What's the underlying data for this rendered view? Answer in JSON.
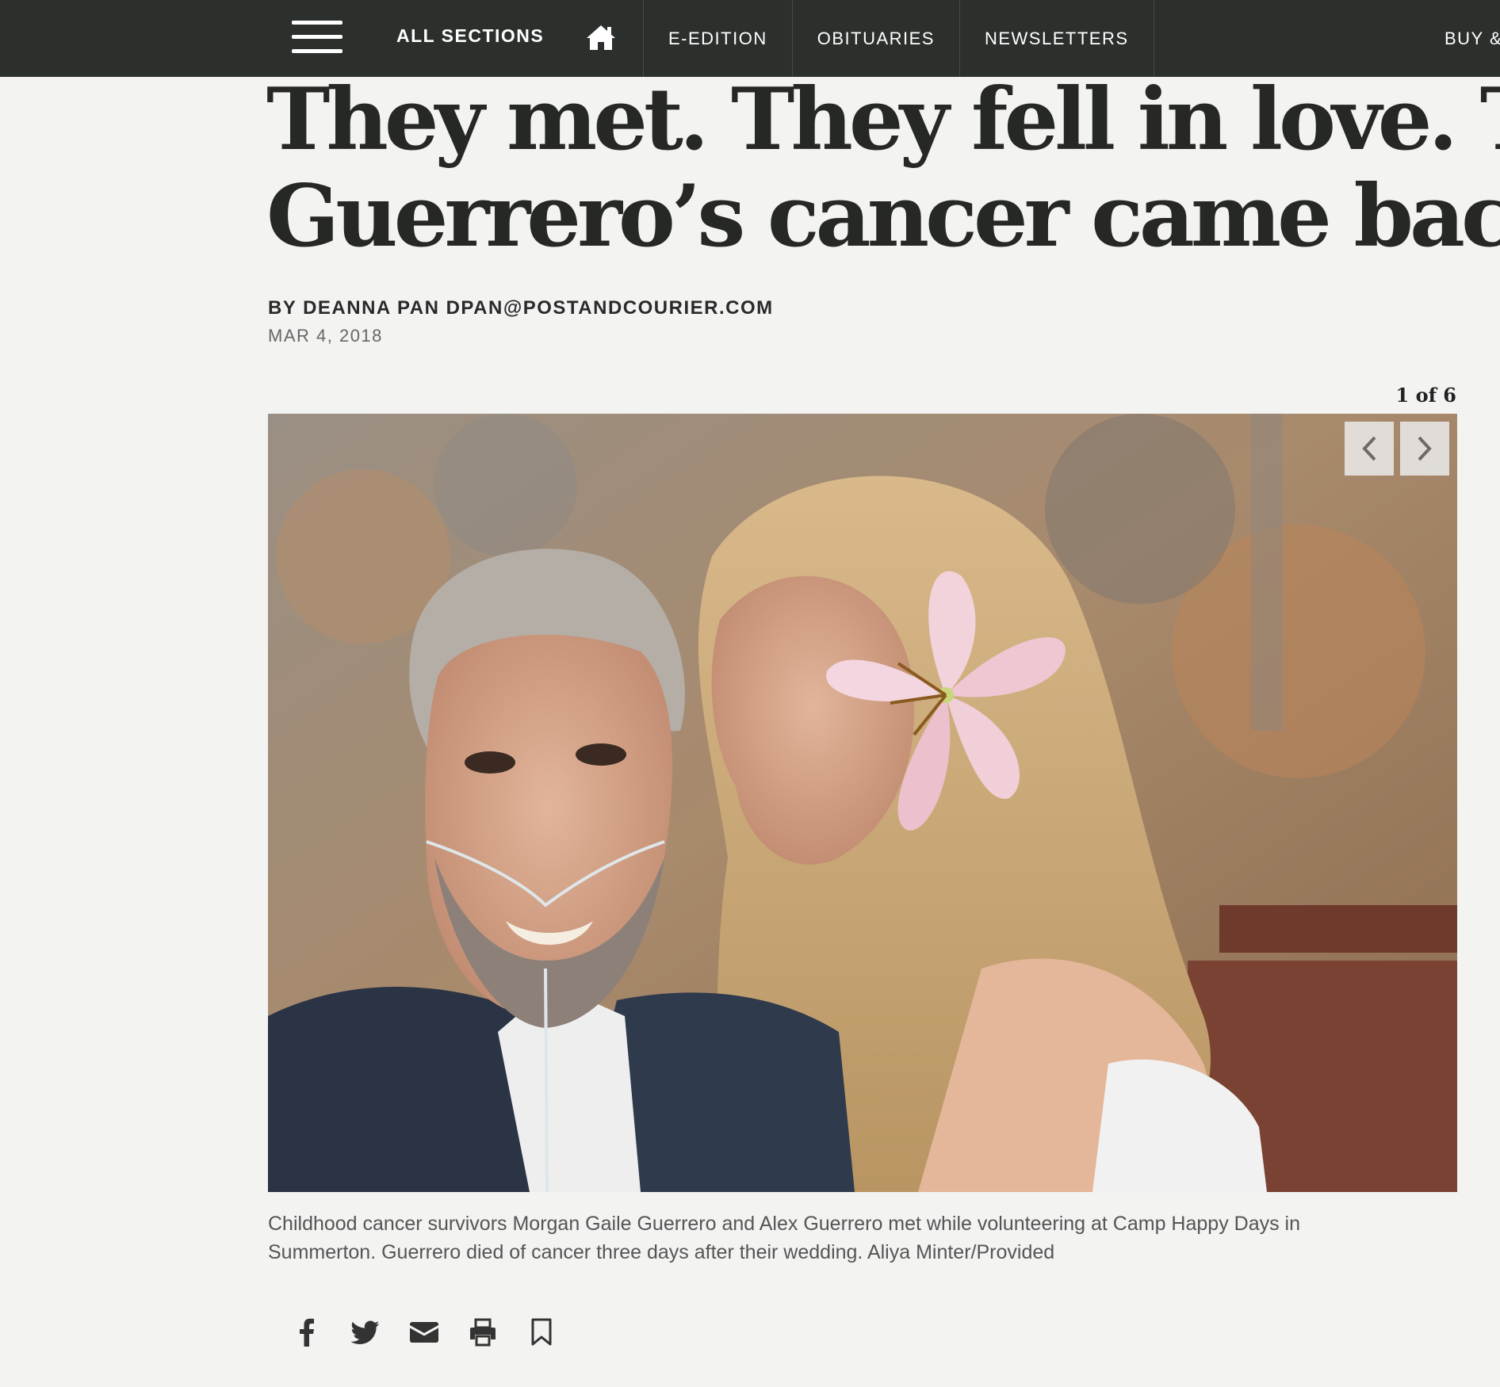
{
  "nav": {
    "all_sections": "ALL SECTIONS",
    "links": [
      "E-EDITION",
      "OBITUARIES",
      "NEWSLETTERS"
    ],
    "right_partial": "BUY &",
    "icons": [
      "menu-icon",
      "home-icon"
    ]
  },
  "article": {
    "headline_line1": "They met. They fell in love. Then Alex",
    "headline_line2": "Guerrero’s cancer came back",
    "byline_prefix": "BY",
    "author": "DEANNA PAN",
    "email": "DPAN@POSTANDCOURIER.COM",
    "date": "MAR 4, 2018"
  },
  "gallery": {
    "counter": "1 of 6",
    "caption": "Childhood cancer survivors Morgan Gaile Guerrero and Alex Guerrero met while volunteering at Camp Happy Days in Summerton. Guerrero died of cancer three days after their wedding. Aliya Minter/Provided",
    "prev_icon": "chevron-left-icon",
    "next_icon": "chevron-right-icon"
  },
  "share": {
    "icons": [
      "facebook-icon",
      "twitter-icon",
      "email-icon",
      "print-icon",
      "bookmark-icon"
    ]
  },
  "colors": {
    "nav_bg": "#2c302d",
    "page_bg": "#f3f3f2",
    "headline": "#262826"
  }
}
